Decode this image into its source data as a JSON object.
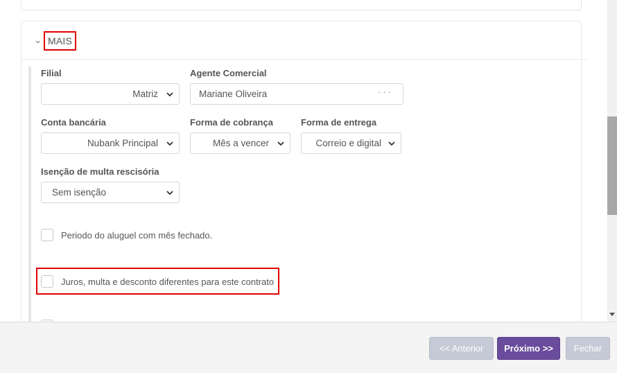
{
  "section": {
    "title": "MAIS"
  },
  "fields": {
    "filial": {
      "label": "Filial",
      "value": "Matriz"
    },
    "agente": {
      "label": "Agente Comercial",
      "value": "Mariane Oliveira",
      "more": "···"
    },
    "conta": {
      "label": "Conta bancária",
      "value": "Nubank Principal"
    },
    "cobranca": {
      "label": "Forma de cobrança",
      "value": "Mês a vencer"
    },
    "entrega": {
      "label": "Forma de entrega",
      "value": "Correio e digital"
    },
    "isencao": {
      "label": "Isenção de multa rescisória",
      "value": "Sem isenção"
    }
  },
  "checkboxes": {
    "periodo": {
      "label": "Periodo do aluguel com mês fechado.",
      "checked": false
    },
    "juros": {
      "label": "Juros, multa e desconto diferentes para este contrato",
      "checked": false
    }
  },
  "footer": {
    "prev_label": "<< Anterior",
    "next_label": "Próximo >>",
    "close_label": "Fechar"
  },
  "colors": {
    "primary": "#6a4c9c",
    "disabled": "#c6c9d6",
    "highlight": "#e00000"
  }
}
